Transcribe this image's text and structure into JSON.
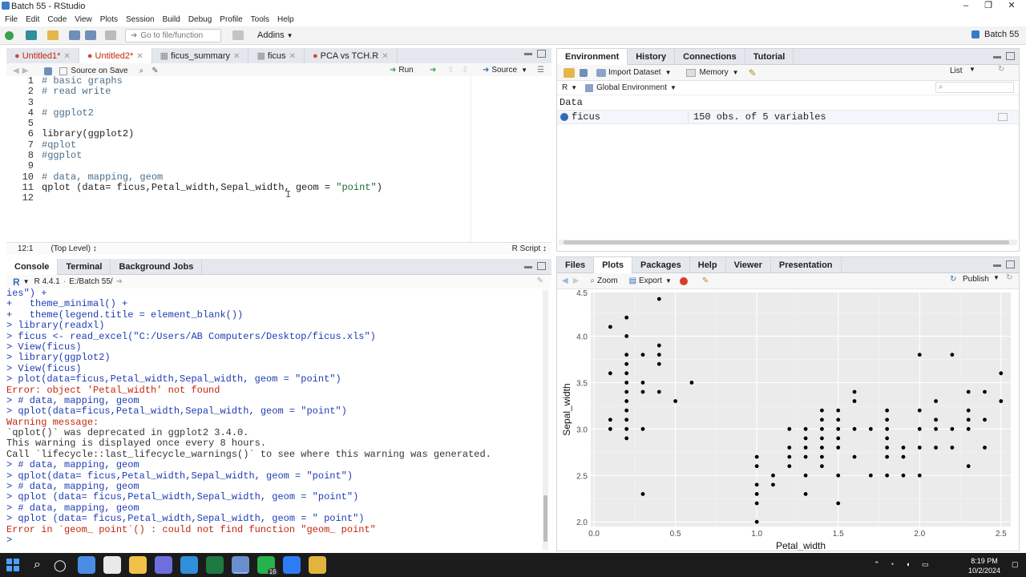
{
  "window": {
    "title": "Batch 55 - RStudio",
    "controls": [
      "–",
      "❐",
      "✕"
    ]
  },
  "menubar": [
    "File",
    "Edit",
    "Code",
    "View",
    "Plots",
    "Session",
    "Build",
    "Debug",
    "Profile",
    "Tools",
    "Help"
  ],
  "toolbar": {
    "goto_placeholder": "Go to file/function",
    "addins": "Addins",
    "project": "Batch 55"
  },
  "editor": {
    "tabs": [
      "Untitled1*",
      "Untitled2*",
      "ficus_summary",
      "ficus",
      "PCA vs TCH.R"
    ],
    "source_on_save": "Source on Save",
    "run": "Run",
    "source": "Source",
    "lines": [
      {
        "n": "1",
        "text": "# basic graphs",
        "kind": "cmt"
      },
      {
        "n": "2",
        "text": "# read write",
        "kind": "cmt"
      },
      {
        "n": "3",
        "text": "",
        "kind": "code"
      },
      {
        "n": "4",
        "text": "# ggplot2",
        "kind": "cmt"
      },
      {
        "n": "5",
        "text": "",
        "kind": "code"
      },
      {
        "n": "6",
        "text": "library(ggplot2)",
        "kind": "code"
      },
      {
        "n": "7",
        "text": "#qplot",
        "kind": "cmt"
      },
      {
        "n": "8",
        "text": "#ggplot",
        "kind": "cmt"
      },
      {
        "n": "9",
        "text": "",
        "kind": "code"
      },
      {
        "n": "10",
        "text": "# data, mapping, geom",
        "kind": "cmt"
      },
      {
        "n": "11",
        "text": "qplot (data= ficus,Petal_width,Sepal_width, geom = \"point\")",
        "kind": "code"
      },
      {
        "n": "12",
        "text": "",
        "kind": "code"
      }
    ],
    "status_pos": "12:1",
    "status_scope": "(Top Level) ↕",
    "status_lang": "R Script ↕"
  },
  "console": {
    "tabs": [
      "Console",
      "Terminal",
      "Background Jobs"
    ],
    "r_version": "R 4.4.1",
    "path": "E:/Batch 55/",
    "lines": [
      {
        "t": "ies\") +",
        "k": "in"
      },
      {
        "t": "+   theme_minimal() +",
        "k": "in"
      },
      {
        "t": "+   theme(legend.title = element_blank())",
        "k": "in"
      },
      {
        "t": "> library(readxl)",
        "k": "in"
      },
      {
        "t": "> ficus <- read_excel(\"C:/Users/AB Computers/Desktop/ficus.xls\")",
        "k": "in"
      },
      {
        "t": "> View(ficus)",
        "k": "in"
      },
      {
        "t": "> library(ggplot2)",
        "k": "in"
      },
      {
        "t": "> View(ficus)",
        "k": "in"
      },
      {
        "t": "> plot(data=ficus,Petal_width,Sepal_width, geom = \"point\")",
        "k": "in"
      },
      {
        "t": "Error: object 'Petal_width' not found",
        "k": "err"
      },
      {
        "t": "> # data, mapping, geom",
        "k": "in"
      },
      {
        "t": "> qplot(data=ficus,Petal_width,Sepal_width, geom = \"point\")",
        "k": "in"
      },
      {
        "t": "Warning message:",
        "k": "err"
      },
      {
        "t": "`qplot()` was deprecated in ggplot2 3.4.0.",
        "k": "out"
      },
      {
        "t": "This warning is displayed once every 8 hours.",
        "k": "out"
      },
      {
        "t": "Call `lifecycle::last_lifecycle_warnings()` to see where this warning was generated.",
        "k": "out"
      },
      {
        "t": "> # data, mapping, geom",
        "k": "in"
      },
      {
        "t": "> qplot(data= ficus,Petal_width,Sepal_width, geom = \"point\")",
        "k": "in"
      },
      {
        "t": "> # data, mapping, geom",
        "k": "in"
      },
      {
        "t": "> qplot (data= ficus,Petal_width,Sepal_width, geom = \"point\")",
        "k": "in"
      },
      {
        "t": "> # data, mapping, geom",
        "k": "in"
      },
      {
        "t": "> qplot (data= ficus,Petal_width,Sepal_width, geom = \" point\")",
        "k": "in"
      },
      {
        "t": "Error in `geom_ point`() : could not find function \"geom_ point\"",
        "k": "err"
      },
      {
        "t": "> ",
        "k": "in"
      }
    ]
  },
  "environment": {
    "tabs": [
      "Environment",
      "History",
      "Connections",
      "Tutorial"
    ],
    "import_dataset": "Import Dataset",
    "memory": "Memory",
    "list_view": "List",
    "lang": "R",
    "scope": "Global Environment",
    "section": "Data",
    "rows": [
      {
        "name": "ficus",
        "value": "150 obs. of 5 variables"
      }
    ]
  },
  "plots": {
    "tabs": [
      "Files",
      "Plots",
      "Packages",
      "Help",
      "Viewer",
      "Presentation"
    ],
    "zoom": "Zoom",
    "export": "Export",
    "publish": "Publish"
  },
  "chart_data": {
    "type": "scatter",
    "xlabel": "Petal_width",
    "ylabel": "Sepal_width",
    "xlim": [
      -0.02,
      2.56
    ],
    "ylim": [
      1.95,
      4.47
    ],
    "xticks": [
      0.0,
      0.5,
      1.0,
      1.5,
      2.0,
      2.5
    ],
    "yticks": [
      2.0,
      2.5,
      3.0,
      3.5,
      4.0,
      4.5
    ],
    "xtick_labels": [
      "0.0",
      "0.5",
      "1.0",
      "1.5",
      "2.0",
      "2.5"
    ],
    "ytick_labels": [
      "2.0",
      "2.5",
      "3.0",
      "3.5",
      "4.0",
      "4.5"
    ],
    "points": [
      [
        0.1,
        4.1
      ],
      [
        0.1,
        3.6
      ],
      [
        0.1,
        3.1
      ],
      [
        0.1,
        3.0
      ],
      [
        0.2,
        4.2
      ],
      [
        0.2,
        4.0
      ],
      [
        0.2,
        3.8
      ],
      [
        0.2,
        3.7
      ],
      [
        0.2,
        3.6
      ],
      [
        0.2,
        3.5
      ],
      [
        0.2,
        3.4
      ],
      [
        0.2,
        3.3
      ],
      [
        0.2,
        3.2
      ],
      [
        0.2,
        3.1
      ],
      [
        0.2,
        3.0
      ],
      [
        0.2,
        2.9
      ],
      [
        0.3,
        3.8
      ],
      [
        0.3,
        3.5
      ],
      [
        0.3,
        3.4
      ],
      [
        0.3,
        3.0
      ],
      [
        0.3,
        2.3
      ],
      [
        0.4,
        4.4
      ],
      [
        0.4,
        3.9
      ],
      [
        0.4,
        3.8
      ],
      [
        0.4,
        3.7
      ],
      [
        0.4,
        3.4
      ],
      [
        0.5,
        3.3
      ],
      [
        0.6,
        3.5
      ],
      [
        1.0,
        2.7
      ],
      [
        1.0,
        2.6
      ],
      [
        1.0,
        2.3
      ],
      [
        1.0,
        2.2
      ],
      [
        1.0,
        2.0
      ],
      [
        1.0,
        2.4
      ],
      [
        1.1,
        2.5
      ],
      [
        1.1,
        2.4
      ],
      [
        1.2,
        3.0
      ],
      [
        1.2,
        2.8
      ],
      [
        1.2,
        2.7
      ],
      [
        1.2,
        2.6
      ],
      [
        1.3,
        3.0
      ],
      [
        1.3,
        2.9
      ],
      [
        1.3,
        2.8
      ],
      [
        1.3,
        2.7
      ],
      [
        1.3,
        2.5
      ],
      [
        1.3,
        2.3
      ],
      [
        1.4,
        3.2
      ],
      [
        1.4,
        3.1
      ],
      [
        1.4,
        3.0
      ],
      [
        1.4,
        2.9
      ],
      [
        1.4,
        2.8
      ],
      [
        1.4,
        2.7
      ],
      [
        1.4,
        2.6
      ],
      [
        1.5,
        3.2
      ],
      [
        1.5,
        3.1
      ],
      [
        1.5,
        3.0
      ],
      [
        1.5,
        2.9
      ],
      [
        1.5,
        2.8
      ],
      [
        1.5,
        2.5
      ],
      [
        1.5,
        2.2
      ],
      [
        1.6,
        3.4
      ],
      [
        1.6,
        3.3
      ],
      [
        1.6,
        3.0
      ],
      [
        1.6,
        2.7
      ],
      [
        1.7,
        3.0
      ],
      [
        1.7,
        2.5
      ],
      [
        1.8,
        3.2
      ],
      [
        1.8,
        3.1
      ],
      [
        1.8,
        3.0
      ],
      [
        1.8,
        2.9
      ],
      [
        1.8,
        2.8
      ],
      [
        1.8,
        2.7
      ],
      [
        1.8,
        2.5
      ],
      [
        1.9,
        2.8
      ],
      [
        1.9,
        2.7
      ],
      [
        1.9,
        2.5
      ],
      [
        2.0,
        3.8
      ],
      [
        2.0,
        3.2
      ],
      [
        2.0,
        3.0
      ],
      [
        2.0,
        2.8
      ],
      [
        2.0,
        2.5
      ],
      [
        2.1,
        3.3
      ],
      [
        2.1,
        3.1
      ],
      [
        2.1,
        3.0
      ],
      [
        2.1,
        2.8
      ],
      [
        2.2,
        3.8
      ],
      [
        2.2,
        3.0
      ],
      [
        2.2,
        2.8
      ],
      [
        2.3,
        3.4
      ],
      [
        2.3,
        3.2
      ],
      [
        2.3,
        3.1
      ],
      [
        2.3,
        3.0
      ],
      [
        2.3,
        2.6
      ],
      [
        2.4,
        3.4
      ],
      [
        2.4,
        3.1
      ],
      [
        2.4,
        2.8
      ],
      [
        2.5,
        3.6
      ],
      [
        2.5,
        3.3
      ]
    ]
  },
  "taskbar": {
    "time": "8:19 PM",
    "date": "10/2/2024",
    "whatsapp_badge": "16"
  },
  "colors": {
    "accent": "#2f6db5",
    "error": "#c5260e",
    "comment": "#4b6e8a",
    "input": "#1f3cb5",
    "plot_bg": "#ebebeb"
  }
}
